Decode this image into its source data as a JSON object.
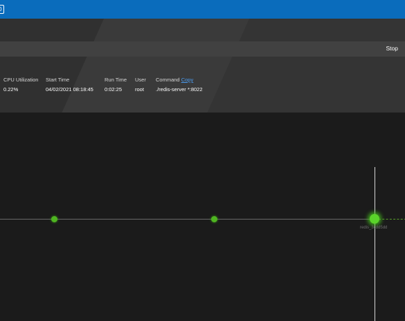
{
  "topbar": {
    "version_badge": "0"
  },
  "toolbar": {
    "stop_label": "Stop"
  },
  "process": {
    "columns": [
      {
        "label": "CPU Utilization",
        "value": "0.22%"
      },
      {
        "label": "Start Time",
        "value": "04/02/2021 08:18:45"
      },
      {
        "label": "Run Time",
        "value": "0:02:25"
      },
      {
        "label": "User",
        "value": "root"
      },
      {
        "label": "Command",
        "link": "Copy",
        "value": "./redis-server *:8022"
      }
    ]
  },
  "timeline": {
    "active_point_label": "redis_3cdd5dd"
  },
  "colors": {
    "accent": "#0a6cbc",
    "point": "#4fb521",
    "link": "#4b9cf0",
    "background": "#1b1b1b"
  }
}
